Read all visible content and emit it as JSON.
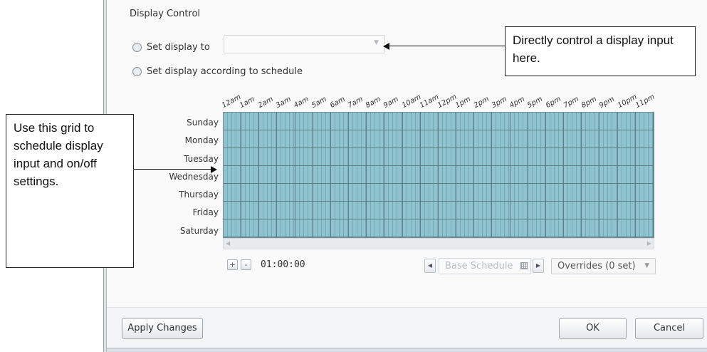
{
  "dialog": {
    "section_title": "Display Control",
    "options": [
      {
        "label": "Set display to"
      },
      {
        "label": "Set display according to schedule"
      }
    ],
    "display_select_value": ""
  },
  "schedule": {
    "hours": [
      "12am",
      "1am",
      "2am",
      "3am",
      "4am",
      "5am",
      "6am",
      "7am",
      "8am",
      "9am",
      "10am",
      "11am",
      "12pm",
      "1pm",
      "2pm",
      "3pm",
      "4pm",
      "5pm",
      "6pm",
      "7pm",
      "8pm",
      "9pm",
      "10pm",
      "11pm"
    ],
    "days": [
      "Sunday",
      "Monday",
      "Tuesday",
      "Wednesday",
      "Thursday",
      "Friday",
      "Saturday"
    ],
    "grid_color": "#8fc3cf",
    "zoom_in": "+",
    "zoom_out": "-",
    "zoom_value": "01:00:00",
    "schedule_name": "Base Schedule",
    "overrides": "Overrides (0 set)"
  },
  "footer": {
    "apply_label": "Apply Changes",
    "ok_label": "OK",
    "cancel_label": "Cancel"
  },
  "callouts": {
    "top": "Directly control a display input here.",
    "left": "Use this grid to schedule display input and on/off settings."
  }
}
